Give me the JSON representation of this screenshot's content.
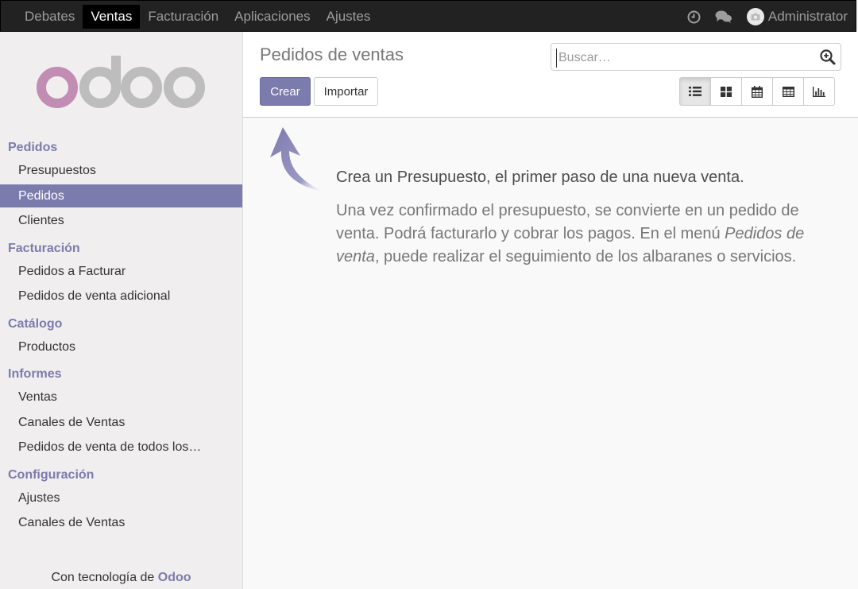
{
  "topbar": {
    "nav": [
      {
        "label": "Debates",
        "active": false
      },
      {
        "label": "Ventas",
        "active": true
      },
      {
        "label": "Facturación",
        "active": false
      },
      {
        "label": "Aplicaciones",
        "active": false
      },
      {
        "label": "Ajustes",
        "active": false
      }
    ],
    "icons": [
      "clock-icon",
      "chat-icon"
    ],
    "user_name": "Administrator"
  },
  "sidebar": {
    "logo_text": "odoo",
    "sections": [
      {
        "title": "Pedidos",
        "items": [
          "Presupuestos",
          "Pedidos",
          "Clientes"
        ]
      },
      {
        "title": "Facturación",
        "items": [
          "Pedidos a Facturar",
          "Pedidos de venta adicional"
        ]
      },
      {
        "title": "Catálogo",
        "items": [
          "Productos"
        ]
      },
      {
        "title": "Informes",
        "items": [
          "Ventas",
          "Canales de Ventas",
          "Pedidos de venta de todos los…"
        ]
      },
      {
        "title": "Configuración",
        "items": [
          "Ajustes",
          "Canales de Ventas"
        ]
      }
    ],
    "active_item": "Pedidos",
    "powered_prefix": "Con tecnología de ",
    "powered_brand": "Odoo"
  },
  "control_panel": {
    "title": "Pedidos de ventas",
    "create_label": "Crear",
    "import_label": "Importar",
    "search_placeholder": "Buscar…",
    "views": [
      "list-view-icon",
      "kanban-view-icon",
      "calendar-view-icon",
      "pivot-view-icon",
      "graph-view-icon"
    ],
    "active_view": "list-view-icon"
  },
  "help": {
    "title": "Crea un Presupuesto, el primer paso de una nueva venta.",
    "body_part1": "Una vez confirmado el presupuesto, se convierte en un pedido de venta. Podrá facturarlo y cobrar los pagos. En el menú ",
    "body_italic": "Pedidos de venta",
    "body_part2": ", puede realizar el seguimiento de los albaranes o servicios."
  },
  "colors": {
    "brand": "#7c7bad",
    "topbar": "#222222",
    "logo_o": "#c28db3",
    "logo_grey": "#bdbdbd"
  }
}
